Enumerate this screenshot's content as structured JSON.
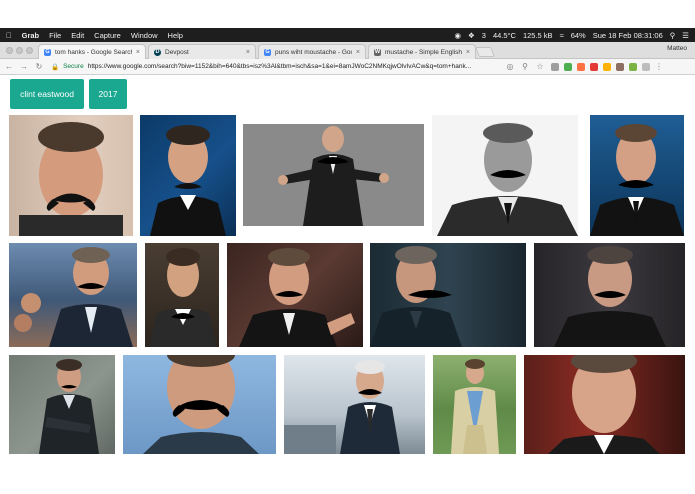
{
  "menubar": {
    "items": [
      "Grab",
      "File",
      "Edit",
      "Capture",
      "Window",
      "Help"
    ],
    "status": [
      "3",
      "44.5°C",
      "125.5 kB",
      "64%",
      "Sue 18 Feb  08:31:06"
    ]
  },
  "tabs": [
    {
      "label": "tom hanks - Google Search",
      "icon": "G",
      "color": "#4285f4"
    },
    {
      "label": "Devpost",
      "icon": "D",
      "color": "#003e54"
    },
    {
      "label": "puns wiht moustache - Google",
      "icon": "G",
      "color": "#4285f4"
    },
    {
      "label": "mustache - Simple English Wi",
      "icon": "W",
      "color": "#666666"
    }
  ],
  "profile": "Matteo",
  "address": {
    "secure": "Secure",
    "url": "https://www.google.com/search?biw=1152&bih=640&tbs=isz%3Al&tbm=isch&sa=1&ei=8amJWoC2NMKqjwOlvIvACw&q=tom+hank..."
  },
  "chips": [
    "clint eastwood",
    "2017"
  ],
  "colors": {
    "chip": "#1ba891",
    "menubar": "#1e1e1e"
  }
}
